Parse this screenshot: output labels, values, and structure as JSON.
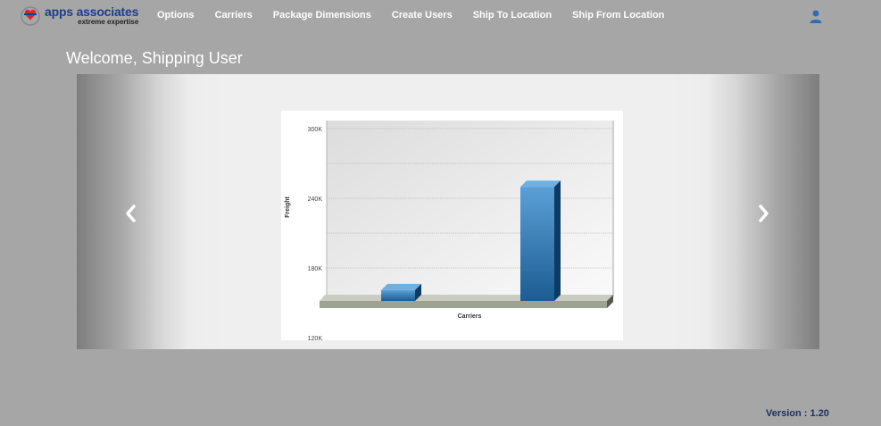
{
  "brand": {
    "name": "apps associates",
    "tagline": "extreme expertise"
  },
  "nav": {
    "items": [
      "Options",
      "Carriers",
      "Package Dimensions",
      "Create Users",
      "Ship To Location",
      "Ship From Location"
    ]
  },
  "user_icon": "user-icon",
  "welcome": "Welcome, Shipping User",
  "carousel": {
    "prev_icon": "chevron-left-icon",
    "next_icon": "chevron-right-icon"
  },
  "chart_data": {
    "type": "bar",
    "title": "",
    "xlabel": "Carriers",
    "ylabel": "Freight",
    "categories": [
      "",
      ""
    ],
    "values": [
      167000,
      256000
    ],
    "ylim": [
      120000,
      300000
    ],
    "yticks": [
      {
        "value": 300000,
        "label": "300K"
      },
      {
        "value": 240000,
        "label": "240K"
      },
      {
        "value": 180000,
        "label": "180K"
      },
      {
        "value": 120000,
        "label": "120K"
      }
    ],
    "grid": true,
    "colors": {
      "bar_front": "#2a6fa8",
      "bar_top": "#6fb0e0",
      "bar_side": "#0d3b63",
      "floor": "#b9bdb0"
    }
  },
  "version": "Version : 1.20"
}
